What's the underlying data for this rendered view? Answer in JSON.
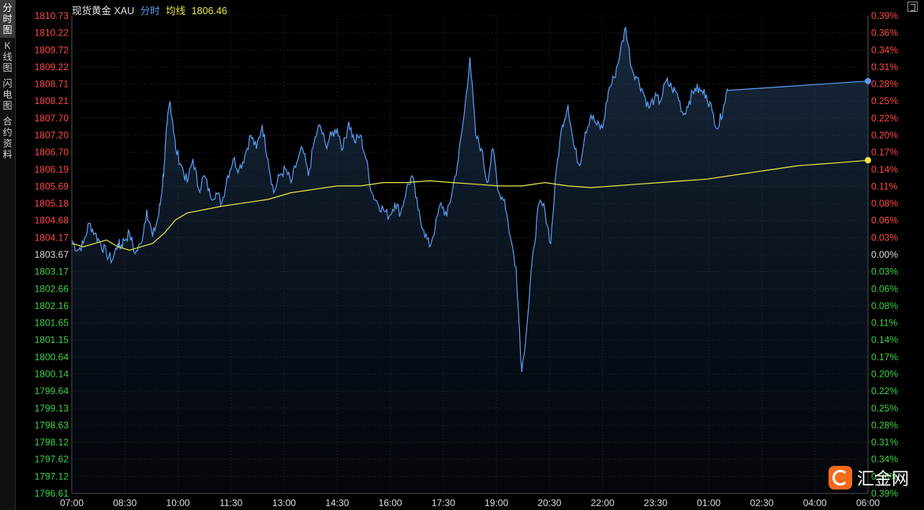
{
  "side_tabs": [
    "分时图",
    "K线图",
    "闪电图",
    "合约资料"
  ],
  "header": {
    "title": "现货黄金 XAU",
    "mode": "分时",
    "avg_label": "均线",
    "avg_value": "1806.46"
  },
  "logo": {
    "text": "汇金网"
  },
  "colors": {
    "price_line": "#5b9bf0",
    "avg_line": "#e8e84a",
    "up": "#ff4a4a",
    "down": "#3fd34a",
    "neutral": "#dddddd",
    "grid": "#2a2a2a"
  },
  "chart_data": {
    "type": "line",
    "ylim": [
      1796.61,
      1810.73
    ],
    "ylim_pct": [
      -0.39,
      0.39
    ],
    "baseline": 1803.67,
    "y_ticks": [
      "1810.73",
      "1810.22",
      "1809.72",
      "1809.22",
      "1808.71",
      "1808.21",
      "1807.70",
      "1807.20",
      "1806.70",
      "1806.19",
      "1805.69",
      "1805.18",
      "1804.68",
      "1804.17",
      "1803.67",
      "1803.17",
      "1802.66",
      "1802.16",
      "1801.65",
      "1801.15",
      "1800.64",
      "1800.14",
      "1799.64",
      "1799.13",
      "1798.63",
      "1798.12",
      "1797.62",
      "1797.12",
      "1796.61"
    ],
    "pct_ticks": [
      "0.39%",
      "0.36%",
      "0.34%",
      "0.31%",
      "0.28%",
      "0.25%",
      "0.22%",
      "0.20%",
      "0.17%",
      "0.14%",
      "0.11%",
      "0.08%",
      "0.06%",
      "0.03%",
      "0.00%",
      "0.03%",
      "0.06%",
      "0.08%",
      "0.11%",
      "0.14%",
      "0.17%",
      "0.20%",
      "0.22%",
      "0.25%",
      "0.28%",
      "0.31%",
      "0.34%",
      "0.36%",
      "0.39%"
    ],
    "x_ticks": [
      "07:00",
      "08:30",
      "10:00",
      "11:30",
      "13:00",
      "14:30",
      "16:00",
      "17:30",
      "19:00",
      "20:30",
      "22:00",
      "23:30",
      "01:00",
      "02:30",
      "04:00",
      "06:00"
    ],
    "x_range_minutes": [
      0,
      1380
    ],
    "series": [
      {
        "values_x_minutes": [
          0,
          10,
          20,
          30,
          40,
          50,
          60,
          70,
          80,
          85,
          90,
          100,
          110,
          120,
          130,
          140,
          150,
          155,
          160,
          165,
          170,
          175,
          180,
          190,
          200,
          210,
          220,
          230,
          240,
          250,
          260,
          270,
          280,
          290,
          300,
          310,
          320,
          330,
          340,
          350,
          360,
          370,
          380,
          390,
          400,
          410,
          420,
          430,
          440,
          450,
          460,
          470,
          480,
          490,
          500,
          510,
          520,
          530,
          540,
          550,
          560,
          570,
          580,
          590,
          600,
          610,
          620,
          630,
          640,
          650,
          660,
          670,
          680,
          690,
          700,
          710,
          720,
          730,
          740,
          750,
          760,
          770,
          780,
          790,
          800,
          810,
          820,
          830,
          840,
          850,
          860,
          870,
          880,
          890,
          900,
          910,
          920,
          930,
          940,
          950,
          960,
          970,
          980,
          990,
          1000,
          1010,
          1020,
          1030,
          1040,
          1050,
          1060,
          1070,
          1080,
          1090,
          1100,
          1110,
          1120,
          1130,
          1140,
          1150,
          1160,
          1170,
          1180,
          1190,
          1200,
          1210,
          1220,
          1230,
          1240,
          1250,
          1260,
          1270,
          1280,
          1290,
          1300,
          1310,
          1320,
          1330,
          1340,
          1350,
          1360,
          1370,
          1380
        ],
        "values": [
          1804.1,
          1803.8,
          1804.0,
          1804.6,
          1804.3,
          1804.0,
          1803.7,
          1803.5,
          1804.0,
          1803.9,
          1804.1,
          1804.3,
          1803.7,
          1804.0,
          1805.0,
          1804.2,
          1804.8,
          1805.4,
          1806.3,
          1807.5,
          1808.2,
          1807.6,
          1806.8,
          1806.3,
          1805.8,
          1806.5,
          1805.6,
          1806.0,
          1805.4,
          1805.5,
          1805.2,
          1806.0,
          1806.5,
          1806.2,
          1806.6,
          1807.2,
          1806.8,
          1807.5,
          1806.5,
          1805.5,
          1806.0,
          1806.2,
          1805.8,
          1806.4,
          1806.8,
          1806.0,
          1807.0,
          1807.5,
          1806.9,
          1807.2,
          1807.4,
          1806.8,
          1807.6,
          1807.0,
          1807.2,
          1806.5,
          1805.5,
          1805.2,
          1805.0,
          1804.8,
          1805.2,
          1804.9,
          1805.6,
          1806.0,
          1805.0,
          1804.4,
          1803.9,
          1804.5,
          1805.2,
          1804.8,
          1805.6,
          1806.5,
          1807.8,
          1809.5,
          1807.2,
          1806.8,
          1805.8,
          1806.8,
          1805.5,
          1805.3,
          1804.2,
          1803.3,
          1800.2,
          1801.8,
          1803.8,
          1805.2,
          1805.0,
          1804.0,
          1806.2,
          1807.5,
          1808.1,
          1806.9,
          1806.3,
          1807.3,
          1807.8,
          1807.5,
          1807.4,
          1808.5,
          1808.9,
          1809.6,
          1810.4,
          1809.2,
          1808.9,
          1808.5,
          1808.0,
          1808.3,
          1808.2,
          1808.8,
          1808.6,
          1808.4,
          1807.8,
          1808.2,
          1808.6,
          1808.5,
          1808.4,
          1807.9,
          1807.4,
          1808.1,
          1808.8
        ],
        "name": ""
      },
      {
        "values_x_minutes": [
          0,
          20,
          40,
          60,
          80,
          100,
          120,
          140,
          160,
          180,
          200,
          230,
          260,
          300,
          340,
          380,
          420,
          460,
          500,
          540,
          580,
          620,
          660,
          700,
          740,
          780,
          820,
          860,
          900,
          940,
          980,
          1020,
          1060,
          1100,
          1140,
          1180,
          1220,
          1260,
          1300,
          1340,
          1380
        ],
        "values": [
          1804.0,
          1803.9,
          1804.0,
          1804.1,
          1803.9,
          1803.8,
          1803.9,
          1804.0,
          1804.3,
          1804.7,
          1804.9,
          1805.0,
          1805.1,
          1805.2,
          1805.3,
          1805.5,
          1805.6,
          1805.7,
          1805.7,
          1805.8,
          1805.8,
          1805.85,
          1805.8,
          1805.75,
          1805.7,
          1805.7,
          1805.8,
          1805.7,
          1805.65,
          1805.7,
          1805.75,
          1805.8,
          1805.85,
          1805.9,
          1806.0,
          1806.1,
          1806.2,
          1806.3,
          1806.35,
          1806.4,
          1806.46
        ],
        "name": "均线"
      }
    ]
  }
}
